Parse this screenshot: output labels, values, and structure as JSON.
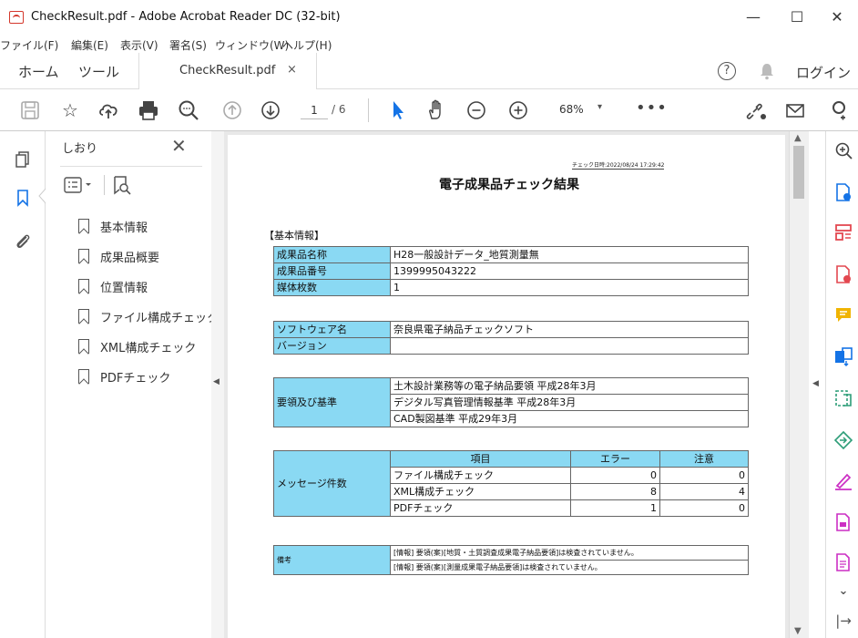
{
  "window": {
    "title": "CheckResult.pdf - Adobe Acrobat Reader DC (32-bit)",
    "minimize": "—",
    "maximize": "☐",
    "close": "✕"
  },
  "menu": [
    "ファイル(F)",
    "編集(E)",
    "表示(V)",
    "署名(S)",
    "ウィンドウ(W)",
    "ヘルプ(H)"
  ],
  "tabs": {
    "home": "ホーム",
    "tools": "ツール",
    "document": "CheckResult.pdf",
    "close": "×"
  },
  "header_right": {
    "help": "?",
    "login": "ログイン"
  },
  "toolbar": {
    "current_page": "1",
    "total_pages": "/ 6",
    "zoom": "68%",
    "more": "•••"
  },
  "bookmarks": {
    "title": "しおり",
    "close": "✕",
    "items": [
      "基本情報",
      "成果品概要",
      "位置情報",
      "ファイル構成チェック",
      "XML構成チェック",
      "PDFチェック"
    ]
  },
  "document": {
    "check_date": "チェック日時:2022/08/24 17:29:42",
    "title": "電子成果品チェック結果",
    "section_basic": "【基本情報】",
    "basic_rows": [
      {
        "label": "成果品名称",
        "value": "H28一般設計データ_地質測量無"
      },
      {
        "label": "成果品番号",
        "value": "1399995043222"
      },
      {
        "label": "媒体枚数",
        "value": "1"
      }
    ],
    "software_rows": [
      {
        "label": "ソフトウェア名",
        "value": "奈良県電子納品チェックソフト"
      },
      {
        "label": "バージョン",
        "value": ""
      }
    ],
    "standards": {
      "label": "要領及び基準",
      "values": [
        "土木設計業務等の電子納品要領 平成28年3月",
        "デジタル写真管理情報基準 平成28年3月",
        "CAD製図基準 平成29年3月"
      ]
    },
    "messages": {
      "label": "メッセージ件数",
      "headers": [
        "項目",
        "エラー",
        "注意"
      ],
      "rows": [
        {
          "item": "ファイル構成チェック",
          "error": "0",
          "warn": "0"
        },
        {
          "item": "XML構成チェック",
          "error": "8",
          "warn": "4"
        },
        {
          "item": "PDFチェック",
          "error": "1",
          "warn": "0"
        }
      ]
    },
    "remarks": {
      "label": "備考",
      "lines": [
        "[情報] 要領(案)[地質・土質調査成果電子納品要領]は検査されていません。",
        "[情報] 要領(案)[測量成果電子納品要領]は検査されていません。"
      ]
    }
  },
  "colors": {
    "accent": "#1473e6",
    "table_header": "#8ad9f3",
    "acrobat_red": "#d4382c"
  }
}
